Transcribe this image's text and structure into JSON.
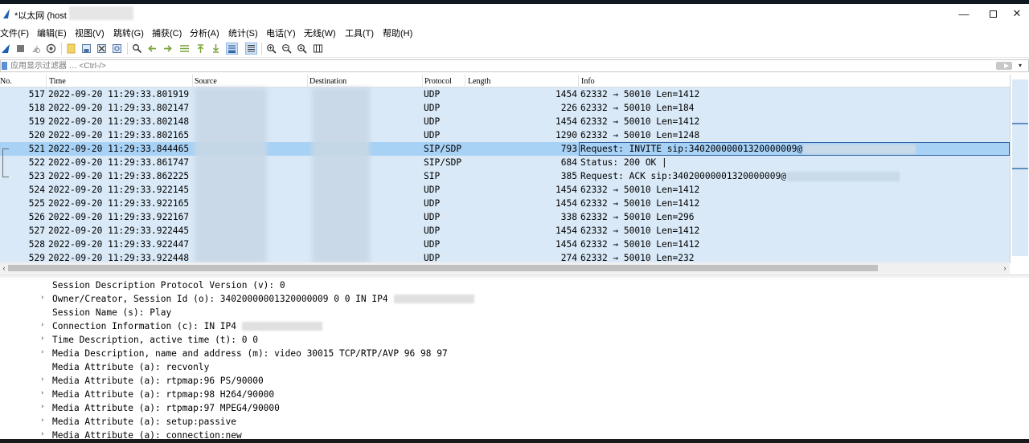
{
  "window": {
    "title": "*以太网 (host",
    "minimize_icon": "minimize-icon",
    "maximize_icon": "maximize-icon",
    "close_icon": "close-icon"
  },
  "menu": [
    "文件(F)",
    "编辑(E)",
    "视图(V)",
    "跳转(G)",
    "捕获(C)",
    "分析(A)",
    "统计(S)",
    "电话(Y)",
    "无线(W)",
    "工具(T)",
    "帮助(H)"
  ],
  "toolbar_icons": [
    "shark-fin-start-icon",
    "stop-icon",
    "restart-icon",
    "capture-options-icon",
    "open-file-icon",
    "save-file-icon",
    "close-file-icon",
    "reload-file-icon",
    "find-packet-icon",
    "go-back-icon",
    "go-forward-icon",
    "go-to-packet-icon",
    "go-first-icon",
    "go-last-icon",
    "autoscroll-icon",
    "colorize-icon",
    "zoom-in-icon",
    "zoom-out-icon",
    "zoom-normal-icon",
    "resize-columns-icon"
  ],
  "filter": {
    "placeholder": "应用显示过滤器 … <Ctrl-/>"
  },
  "columns": {
    "no": "No.",
    "time": "Time",
    "source": "Source",
    "destination": "Destination",
    "protocol": "Protocol",
    "length": "Length",
    "info": "Info"
  },
  "packets": [
    {
      "no": "517",
      "time": "2022-09-20 11:29:33.801919",
      "protocol": "UDP",
      "length": "1454",
      "info": "62332 → 50010 Len=1412"
    },
    {
      "no": "518",
      "time": "2022-09-20 11:29:33.802147",
      "protocol": "UDP",
      "length": "226",
      "info": "62332 → 50010 Len=184"
    },
    {
      "no": "519",
      "time": "2022-09-20 11:29:33.802148",
      "protocol": "UDP",
      "length": "1454",
      "info": "62332 → 50010 Len=1412"
    },
    {
      "no": "520",
      "time": "2022-09-20 11:29:33.802165",
      "protocol": "UDP",
      "length": "1290",
      "info": "62332 → 50010 Len=1248"
    },
    {
      "no": "521",
      "time": "2022-09-20 11:29:33.844465",
      "protocol": "SIP/SDP",
      "length": "793",
      "info": "Request: INVITE sip:34020000001320000009@"
    },
    {
      "no": "522",
      "time": "2022-09-20 11:29:33.861747",
      "protocol": "SIP/SDP",
      "length": "684",
      "info": "Status: 200 OK |"
    },
    {
      "no": "523",
      "time": "2022-09-20 11:29:33.862225",
      "protocol": "SIP",
      "length": "385",
      "info": "Request: ACK sip:34020000001320000009@"
    },
    {
      "no": "524",
      "time": "2022-09-20 11:29:33.922145",
      "protocol": "UDP",
      "length": "1454",
      "info": "62332 → 50010 Len=1412"
    },
    {
      "no": "525",
      "time": "2022-09-20 11:29:33.922165",
      "protocol": "UDP",
      "length": "1454",
      "info": "62332 → 50010 Len=1412"
    },
    {
      "no": "526",
      "time": "2022-09-20 11:29:33.922167",
      "protocol": "UDP",
      "length": "338",
      "info": "62332 → 50010 Len=296"
    },
    {
      "no": "527",
      "time": "2022-09-20 11:29:33.922445",
      "protocol": "UDP",
      "length": "1454",
      "info": "62332 → 50010 Len=1412"
    },
    {
      "no": "528",
      "time": "2022-09-20 11:29:33.922447",
      "protocol": "UDP",
      "length": "1454",
      "info": "62332 → 50010 Len=1412"
    },
    {
      "no": "529",
      "time": "2022-09-20 11:29:33.922448",
      "protocol": "UDP",
      "length": "274",
      "info": "62332 → 50010 Len=232"
    }
  ],
  "selected_packet": "521",
  "details": [
    {
      "expandable": false,
      "text": "Session Description Protocol Version (v): 0"
    },
    {
      "expandable": true,
      "text": "Owner/Creator, Session Id (o): 34020000001320000009 0 0 IN IP4 "
    },
    {
      "expandable": false,
      "text": "Session Name (s): Play"
    },
    {
      "expandable": true,
      "text": "Connection Information (c): IN IP4 "
    },
    {
      "expandable": true,
      "text": "Time Description, active time (t): 0 0"
    },
    {
      "expandable": true,
      "text": "Media Description, name and address (m): video 30015 TCP/RTP/AVP 96 98 97"
    },
    {
      "expandable": false,
      "text": "Media Attribute (a): recvonly"
    },
    {
      "expandable": true,
      "text": "Media Attribute (a): rtpmap:96 PS/90000"
    },
    {
      "expandable": true,
      "text": "Media Attribute (a): rtpmap:98 H264/90000"
    },
    {
      "expandable": true,
      "text": "Media Attribute (a): rtpmap:97 MPEG4/90000"
    },
    {
      "expandable": true,
      "text": "Media Attribute (a): setup:passive"
    },
    {
      "expandable": true,
      "text": "Media Attribute (a): connection:new"
    }
  ],
  "colors": {
    "row_background": "#d9e9f7",
    "row_selected": "#a7d1f5",
    "accent": "#2a5fa0"
  }
}
